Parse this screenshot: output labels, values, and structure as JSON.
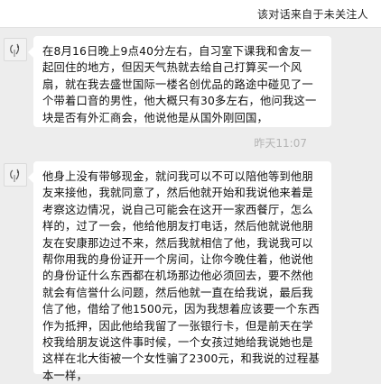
{
  "notice": {
    "text": "该对话来自于未关注人"
  },
  "messages": [
    {
      "text": "在8月16日晚上9点40分左右，自习室下课我和舍友一起回住的地方，但因天气热就去给自己打算买一个风扇，就在我去盛世国际一楼名创优品的路途中碰见了一个带着口音的男性，他大概只有30多左右，他问我这一块是否有外汇商会，他说他是从国外刚回国，"
    },
    {
      "text": "他身上没有带够现金，就问我可以不可以陪他等到他朋友来接他，我就同意了，然后他就开始和我说他来着是考察这边情况，说自己可能会在这开一家西餐厅，怎么样的，过了一会，他给他朋友打电话，然后他就说他朋友在安康那边过不来，然后我就相信了他，我说我可以帮你用我的身份证开一个房间，让你今晚住着，他说他的身份证什么东西都在机场那边他必须回去，要不然他就会有信誉什么问题，然后他就一直在给我说，最后我信了他，借给了他1500元，因为我想着应该要一个东西作为抵押，因此他给我留了一张银行卡，但是前天在学校我给朋友说这件事时候，一个女孩过她给我说她也是这样在北大街被一个女性骗了2300元，和我说的过程基本一样，"
    }
  ],
  "timestamp": "昨天11:07"
}
